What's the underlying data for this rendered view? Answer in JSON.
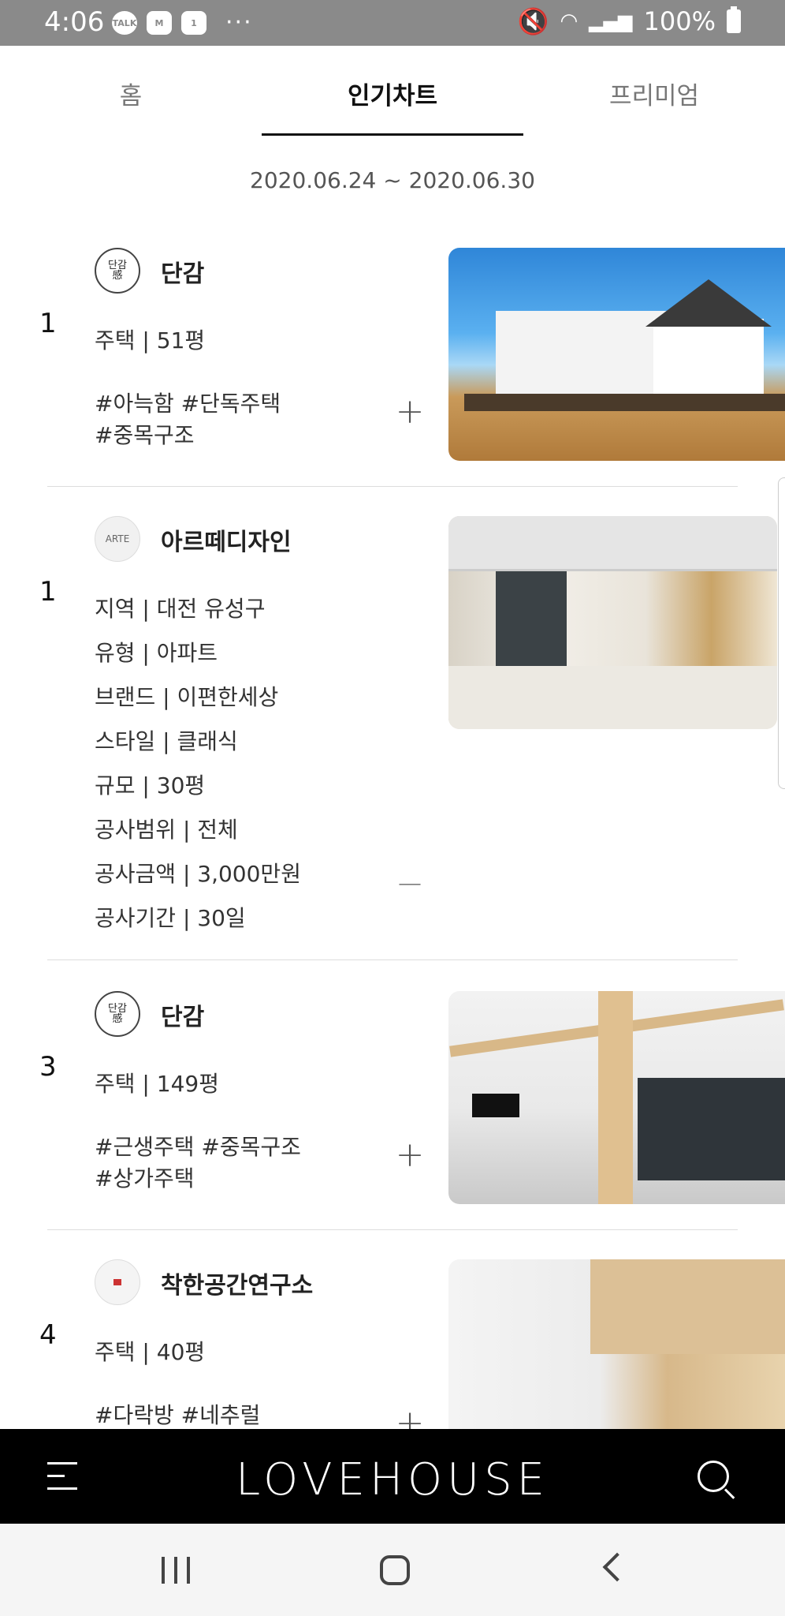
{
  "status_bar": {
    "time": "4:06",
    "notif_icons": [
      "TALK",
      "M",
      "1"
    ],
    "more": "···",
    "battery": "100%"
  },
  "tabs": [
    {
      "label": "홈",
      "active": false
    },
    {
      "label": "인기차트",
      "active": true
    },
    {
      "label": "프리미엄",
      "active": false
    }
  ],
  "date_range": "2020.06.24 ~ 2020.06.30",
  "cards": [
    {
      "rank": "1",
      "company": "단감",
      "lines": [
        "주택 | 51평",
        "#아늑함 #단독주택",
        "#중목구조"
      ],
      "toggle": "+",
      "image": "exterior-house-photo"
    },
    {
      "rank": "1",
      "company": "아르떼디자인",
      "lines": [
        "지역 | 대전 유성구",
        "유형 | 아파트",
        "브랜드 | 이편한세상",
        "스타일 | 클래식",
        "규모 | 30평",
        "공사범위 | 전체",
        "공사금액 | 3,000만원",
        "공사기간 | 30일"
      ],
      "toggle": "—",
      "image": "cafe-interior-photo"
    },
    {
      "rank": "3",
      "company": "단감",
      "lines": [
        "주택 | 149평",
        "#근생주택 #중목구조",
        "#상가주택"
      ],
      "toggle": "+",
      "image": "living-kitchen-photo"
    },
    {
      "rank": "4",
      "company": "착한공간연구소",
      "lines": [
        "주택 | 40평",
        "#다락방 #네추럴"
      ],
      "toggle": "+",
      "image": "loft-interior-photo"
    }
  ],
  "app_bar": {
    "brand": "LOVEHOUSE",
    "menu_icon": "hamburger-menu-icon",
    "search_icon": "search-icon"
  },
  "system_nav": {
    "buttons": [
      "recent-apps",
      "home",
      "back"
    ]
  }
}
